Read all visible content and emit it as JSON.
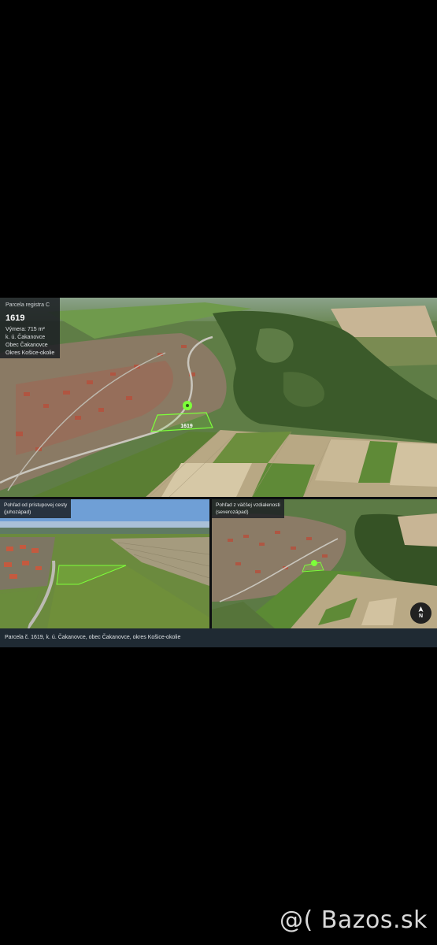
{
  "main_view": {
    "info": {
      "kicker": "Parcela registra C",
      "number": "1619",
      "area": "Výmera: 715 m²",
      "cadastral": "k. ú. Čakanovce",
      "municipality": "Obec Čakanovce",
      "district": "Okres Košice-okolie"
    },
    "plot_label": "1619"
  },
  "view_southwest": {
    "title_line1": "Pohľad od prístupovej cesty",
    "title_line2": "(juhozápad)"
  },
  "view_northwest": {
    "title_line1": "Pohľad z väčšej vzdialenosti",
    "title_line2": "(severozápad)",
    "compass_letter": "N"
  },
  "caption": "Parcela č. 1619, k. ú. Čakanovce, obec Čakanovce, okres Košice-okolie",
  "watermark": "@( Bazos.sk",
  "colors": {
    "plot_outline": "#7dff3a",
    "panel_bg": "#1c2024",
    "caption_bg": "#1f2a33"
  }
}
